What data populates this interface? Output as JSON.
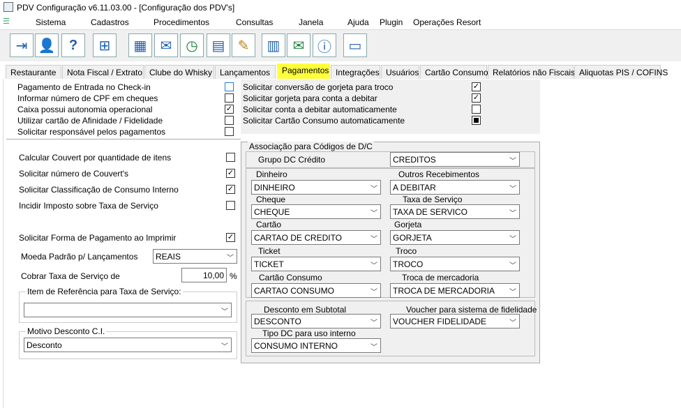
{
  "window": {
    "title": "PDV Configuração v6.11.03.00 - [Configuração dos PDV's]"
  },
  "menu": [
    "Sistema",
    "Cadastros",
    "Procedimentos",
    "Consultas",
    "Janela",
    "Ajuda",
    "Plugin",
    "Operações Resort"
  ],
  "toolbar": {
    "icons": [
      "exit-icon",
      "user-icon",
      "help-icon",
      "network-icon",
      "register-icon",
      "mail-icon",
      "clock-icon",
      "report-icon",
      "notes-icon",
      "calculator-icon",
      "send-mail-icon",
      "info-monitor-icon",
      "card-icon"
    ]
  },
  "tabs": [
    "Restaurante",
    "Nota Fiscal / Extrato",
    "Clube do Whisky",
    "Lançamentos",
    "Pagamentos",
    "Integrações",
    "Usuários",
    "Cartão Consumo",
    "Relatórios não Fiscais",
    "Aliquotas PIS / COFINS"
  ],
  "active_tab": "Pagamentos",
  "left_top": [
    {
      "label": "Pagamento de Entrada no Check-in",
      "checked": false
    },
    {
      "label": "Informar número de CPF em cheques",
      "checked": false
    },
    {
      "label": "Caixa possui autonomia operacional",
      "checked": true
    },
    {
      "label": "Utilizar cartão de Afinidade / Fidelidade",
      "checked": false
    },
    {
      "label": "Solicitar responsável pelos pagamentos",
      "checked": false
    }
  ],
  "right_top": [
    {
      "label": "Solicitar conversão de gorjeta para troco",
      "checked": true
    },
    {
      "label": "Solicitar gorjeta para conta a debitar",
      "checked": true
    },
    {
      "label": "Solicitar conta a debitar automaticamente",
      "checked": false
    },
    {
      "label": "Solicitar Cartão Consumo automaticamente",
      "checked": "partial"
    }
  ],
  "left_mid": [
    {
      "label": "Calcular Couvert por quantidade de itens",
      "checked": false
    },
    {
      "label": "Solicitar número de Couvert's",
      "checked": true
    },
    {
      "label": "Solicitar Classificação de Consumo Interno",
      "checked": true
    },
    {
      "label": "Incidir Imposto sobre Taxa de Serviço",
      "checked": false
    },
    {
      "label": "Solicitar Forma de Pagamento ao Imprimir",
      "checked": true
    }
  ],
  "moeda": {
    "label": "Moeda Padrão p/ Lançamentos",
    "value": "REAIS"
  },
  "taxa": {
    "label": "Cobrar Taxa de Serviço de",
    "value": "10,00",
    "unit": "%"
  },
  "item_ref": {
    "title": "Item de Referência para Taxa de Serviço:",
    "value": ""
  },
  "motivo": {
    "title": "Motivo Desconto C.I.",
    "value": "Desconto"
  },
  "assoc": {
    "title": "Associação para Códigos de D/C",
    "grupo": {
      "label": "Grupo DC Crédito",
      "value": "CREDITOS"
    },
    "fields": [
      {
        "label": "Dinheiro",
        "value": "DINHEIRO"
      },
      {
        "label": "Outros Recebimentos",
        "value": "A DEBITAR"
      },
      {
        "label": "Cheque",
        "value": "CHEQUE"
      },
      {
        "label": "Taxa de Serviço",
        "value": "TAXA DE SERVICO"
      },
      {
        "label": "Cartão",
        "value": "CARTAO DE CREDITO"
      },
      {
        "label": "Gorjeta",
        "value": "GORJETA"
      },
      {
        "label": "Ticket",
        "value": "TICKET"
      },
      {
        "label": "Troco",
        "value": "TROCO"
      },
      {
        "label": "Cartão Consumo",
        "value": "CARTAO CONSUMO"
      },
      {
        "label": "Troca de mercadoria",
        "value": "TROCA DE MERCADORIA"
      }
    ],
    "desconto": {
      "label": "Desconto em Subtotal",
      "value": "DESCONTO"
    },
    "voucher": {
      "label": "Voucher para sistema de fidelidade",
      "value": "VOUCHER FIDELIDADE"
    },
    "tipo_dc": {
      "label": "Tipo DC para uso interno",
      "value": "CONSUMO INTERNO"
    }
  }
}
